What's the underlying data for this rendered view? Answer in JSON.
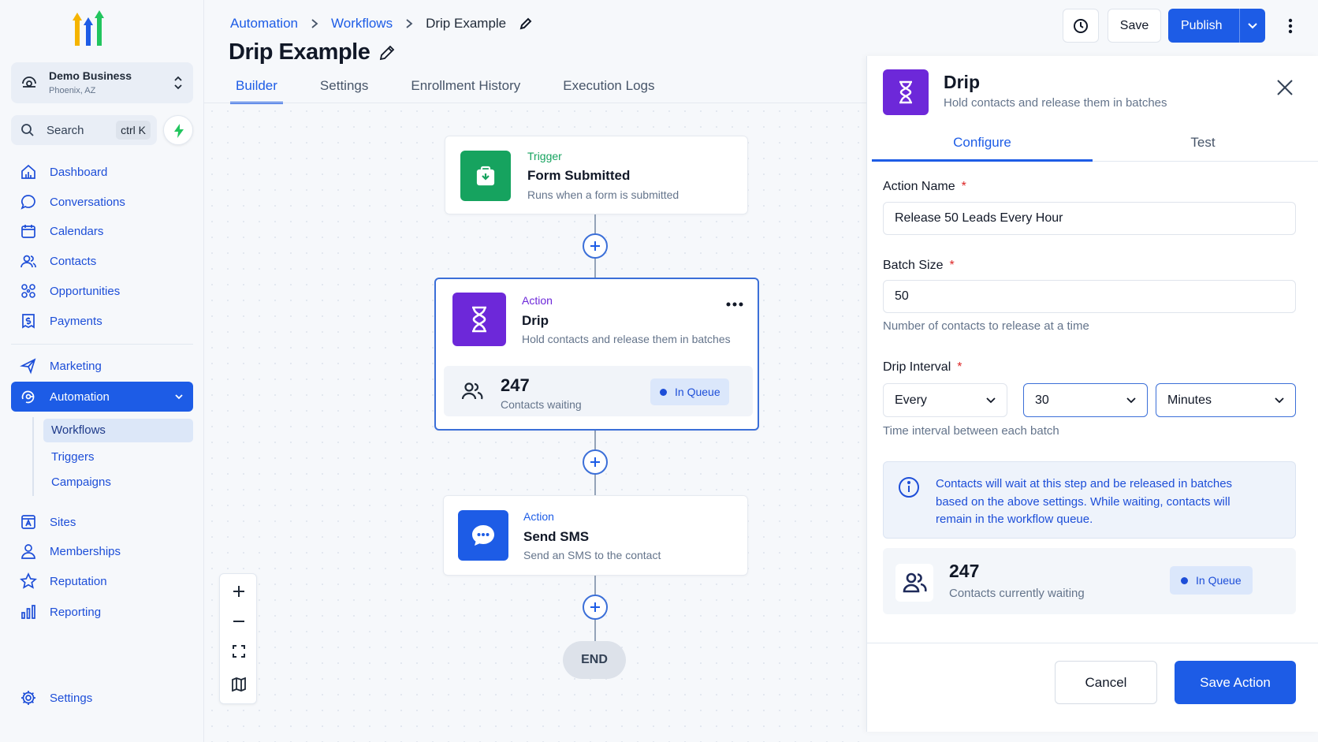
{
  "sidebar": {
    "business": {
      "name": "Demo Business",
      "location": "Phoenix, AZ"
    },
    "search": {
      "label": "Search",
      "shortcut": "ctrl K"
    },
    "nav_primary": [
      {
        "label": "Dashboard",
        "icon": "dashboard-icon"
      },
      {
        "label": "Conversations",
        "icon": "chat-bubble-icon"
      },
      {
        "label": "Calendars",
        "icon": "calendar-icon"
      },
      {
        "label": "Contacts",
        "icon": "contacts-icon"
      },
      {
        "label": "Opportunities",
        "icon": "opportunities-icon"
      },
      {
        "label": "Payments",
        "icon": "payments-icon"
      }
    ],
    "nav_marketing": {
      "label": "Marketing",
      "icon": "send-icon"
    },
    "nav_automation": {
      "label": "Automation",
      "icon": "automation-icon"
    },
    "automation_sub": [
      {
        "label": "Workflows",
        "active": true
      },
      {
        "label": "Triggers",
        "active": false
      },
      {
        "label": "Campaigns",
        "active": false
      }
    ],
    "nav_secondary": [
      {
        "label": "Sites",
        "icon": "sites-icon"
      },
      {
        "label": "Memberships",
        "icon": "user-icon"
      },
      {
        "label": "Reputation",
        "icon": "star-icon"
      },
      {
        "label": "Reporting",
        "icon": "bar-chart-icon"
      }
    ],
    "settings": {
      "label": "Settings",
      "icon": "gear-icon"
    }
  },
  "header": {
    "breadcrumb": [
      "Automation",
      "Workflows",
      "Drip Example"
    ],
    "title": "Drip Example",
    "tabs": [
      {
        "label": "Builder",
        "active": true
      },
      {
        "label": "Settings",
        "active": false
      },
      {
        "label": "Enrollment History",
        "active": false
      },
      {
        "label": "Execution Logs",
        "active": false
      }
    ],
    "save_label": "Save",
    "publish_label": "Publish"
  },
  "canvas": {
    "trigger": {
      "type": "Trigger",
      "title": "Form Submitted",
      "desc": "Runs when a form is submitted",
      "color": "#16a35f"
    },
    "drip": {
      "type": "Action",
      "title": "Drip",
      "desc": "Hold contacts and release them in batches",
      "waiting_count": "247",
      "waiting_label": "Contacts waiting",
      "status": "In Queue",
      "color": "#6d28d9"
    },
    "sms": {
      "type": "Action",
      "title": "Send SMS",
      "desc": "Send an SMS to the contact",
      "color": "#1d5ce6"
    },
    "end_label": "END"
  },
  "panel": {
    "title": "Drip",
    "subtitle": "Hold contacts and release them in batches",
    "tabs": [
      {
        "label": "Configure",
        "active": true
      },
      {
        "label": "Test",
        "active": false
      }
    ],
    "action_name": {
      "label": "Action Name",
      "value": "Release 50 Leads Every Hour"
    },
    "batch_size": {
      "label": "Batch Size",
      "value": "50",
      "help": "Number of contacts to release at a time"
    },
    "drip_interval": {
      "label": "Drip Interval",
      "every": "Every",
      "amount": "30",
      "unit": "Minutes",
      "help": "Time interval between each batch"
    },
    "required_mark": "*",
    "info": "Contacts will wait at this step and be released in batches based on the above settings. While waiting, contacts will remain in the workflow queue.",
    "waiting": {
      "count": "247",
      "label": "Contacts currently waiting",
      "status": "In Queue"
    },
    "cancel_label": "Cancel",
    "save_label": "Save Action"
  }
}
